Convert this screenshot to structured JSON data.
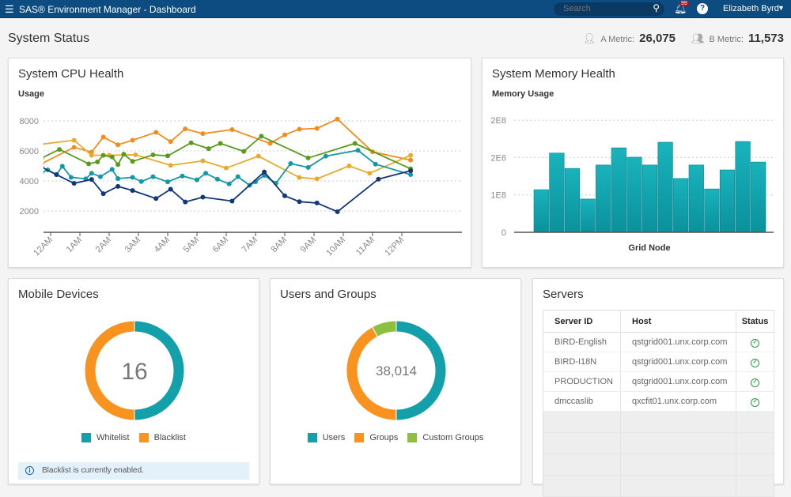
{
  "header": {
    "menu_icon": "hamburger-icon",
    "title": "SAS® Environment Manager - Dashboard",
    "search_placeholder": "Search",
    "notification_count": "99",
    "help_label": "?",
    "user_name": "Elizabeth Byrd"
  },
  "page": {
    "title": "System Status",
    "metric_a_label": "A Metric:",
    "metric_a_value": "26,075",
    "metric_b_label": "B Metric:",
    "metric_b_value": "11,573"
  },
  "cpu": {
    "title": "System CPU Health",
    "subtitle": "Usage"
  },
  "memory": {
    "title": "System Memory Health",
    "subtitle": "Memory Usage"
  },
  "mobile": {
    "title": "Mobile Devices",
    "center": "16",
    "legend": [
      "Whitelist",
      "Blacklist"
    ],
    "info": "Blacklist is currently enabled."
  },
  "users": {
    "title": "Users and Groups",
    "center": "38,014",
    "legend": [
      "Users",
      "Groups",
      "Custom Groups"
    ]
  },
  "servers": {
    "title": "Servers",
    "columns": [
      "Server ID",
      "Host",
      "Status"
    ],
    "rows": [
      [
        "BIRD-English",
        "qstgrid001.unx.corp.com",
        "ok"
      ],
      [
        "BIRD-I18N",
        "qstgrid001.unx.corp.com",
        "ok"
      ],
      [
        "PRODUCTION",
        "qstgrid001.unx.corp.com",
        "ok"
      ],
      [
        "dmccaslib",
        "qxcfit01.unx.corp.com",
        "ok"
      ]
    ]
  },
  "chart_data": [
    {
      "type": "line",
      "title": "System CPU Health",
      "ylabel": "Usage",
      "x_unit": "hour",
      "x_ticks": [
        "12AM",
        "1AM",
        "2AM",
        "3AM",
        "4AM",
        "5AM",
        "6AM",
        "7AM",
        "8AM",
        "9AM",
        "10AM",
        "11AM",
        "12PM"
      ],
      "y_ticks": [
        2000,
        4000,
        6000,
        8000
      ],
      "grid": "horizontal dotted",
      "series": [
        {
          "color": "#f28c1f",
          "points": [
            [
              -0.3,
              5160
            ],
            [
              0.8,
              6240
            ],
            [
              1.4,
              5920
            ],
            [
              1.8,
              6920
            ],
            [
              2.3,
              6410
            ],
            [
              2.8,
              6710
            ],
            [
              3.6,
              7240
            ],
            [
              4.1,
              6620
            ],
            [
              4.6,
              7470
            ],
            [
              5.2,
              7150
            ],
            [
              6.2,
              7420
            ],
            [
              7.5,
              6500
            ],
            [
              8.0,
              7070
            ],
            [
              8.5,
              7450
            ],
            [
              9.1,
              7500
            ],
            [
              9.8,
              8120
            ],
            [
              11.0,
              5940
            ],
            [
              12.3,
              5390
            ]
          ]
        },
        {
          "color": "#e8ac2c",
          "points": [
            [
              -0.3,
              6450
            ],
            [
              0.8,
              6710
            ],
            [
              1.4,
              5710
            ],
            [
              2.0,
              5710
            ],
            [
              2.9,
              5740
            ],
            [
              4.1,
              5040
            ],
            [
              5.2,
              5340
            ],
            [
              6.0,
              4860
            ],
            [
              7.1,
              5650
            ],
            [
              8.5,
              4230
            ],
            [
              9.1,
              4140
            ],
            [
              10.2,
              5000
            ],
            [
              10.9,
              4510
            ],
            [
              12.3,
              5710
            ]
          ]
        },
        {
          "color": "#5a9a1c",
          "points": [
            [
              -0.3,
              5530
            ],
            [
              0.3,
              6100
            ],
            [
              1.3,
              5140
            ],
            [
              1.6,
              5270
            ],
            [
              1.8,
              5710
            ],
            [
              2.1,
              5600
            ],
            [
              2.3,
              5090
            ],
            [
              2.5,
              5780
            ],
            [
              2.8,
              5300
            ],
            [
              3.5,
              5740
            ],
            [
              4.0,
              5670
            ],
            [
              4.8,
              6540
            ],
            [
              5.4,
              6150
            ],
            [
              5.8,
              6500
            ],
            [
              6.6,
              5970
            ],
            [
              7.2,
              6980
            ],
            [
              8.8,
              5530
            ],
            [
              10.4,
              6500
            ],
            [
              12.3,
              4810
            ]
          ]
        },
        {
          "color": "#1697a6",
          "points": [
            [
              -0.3,
              4560
            ],
            [
              -0.1,
              4740
            ],
            [
              0.2,
              4420
            ],
            [
              0.4,
              4980
            ],
            [
              0.7,
              4240
            ],
            [
              1.2,
              4140
            ],
            [
              1.4,
              4510
            ],
            [
              1.7,
              4280
            ],
            [
              2.1,
              4770
            ],
            [
              2.3,
              4160
            ],
            [
              2.8,
              4240
            ],
            [
              3.1,
              3960
            ],
            [
              3.5,
              4280
            ],
            [
              4.0,
              3940
            ],
            [
              4.5,
              4330
            ],
            [
              5.0,
              4070
            ],
            [
              5.3,
              4510
            ],
            [
              5.7,
              4120
            ],
            [
              6.1,
              3800
            ],
            [
              6.4,
              4280
            ],
            [
              6.8,
              3710
            ],
            [
              7.0,
              3940
            ],
            [
              7.3,
              4370
            ],
            [
              7.7,
              3850
            ],
            [
              8.2,
              5160
            ],
            [
              8.8,
              4900
            ],
            [
              9.4,
              5650
            ],
            [
              10.5,
              6040
            ],
            [
              11.1,
              5120
            ],
            [
              12.3,
              4420
            ]
          ]
        },
        {
          "color": "#12377a",
          "points": [
            [
              -0.3,
              4910
            ],
            [
              0.2,
              4420
            ],
            [
              0.8,
              3840
            ],
            [
              1.4,
              4100
            ],
            [
              1.8,
              3150
            ],
            [
              2.3,
              3640
            ],
            [
              2.8,
              3360
            ],
            [
              3.6,
              2830
            ],
            [
              4.1,
              3450
            ],
            [
              4.6,
              2600
            ],
            [
              5.2,
              2920
            ],
            [
              6.2,
              2660
            ],
            [
              7.3,
              4600
            ],
            [
              8.0,
              3010
            ],
            [
              8.5,
              2620
            ],
            [
              9.1,
              2530
            ],
            [
              9.8,
              1950
            ],
            [
              11.2,
              4120
            ],
            [
              12.3,
              4680
            ]
          ]
        }
      ]
    },
    {
      "type": "bar",
      "title": "System Memory Health",
      "ylabel": "Memory Usage",
      "xlabel": "Grid Node",
      "y_tick_labels": [
        "0",
        "1E8",
        "2E6",
        "2E8"
      ],
      "value_unit": "tick steps",
      "values": [
        1.14,
        2.12,
        1.71,
        0.89,
        1.8,
        2.26,
        2.01,
        1.8,
        2.41,
        1.44,
        1.8,
        1.16,
        1.67,
        2.43,
        1.88
      ],
      "color": "#13a3ad",
      "grid": "horizontal dotted"
    },
    {
      "type": "pie",
      "title": "Mobile Devices",
      "center_label": "16",
      "labels": [
        "Whitelist",
        "Blacklist"
      ],
      "values": [
        50,
        50
      ],
      "colors": [
        "#13a0aa",
        "#f7931e"
      ]
    },
    {
      "type": "pie",
      "title": "Users and Groups",
      "center_label": "38,014",
      "labels": [
        "Users",
        "Groups",
        "Custom Groups"
      ],
      "values": [
        50,
        42,
        8
      ],
      "colors": [
        "#13a0aa",
        "#f7931e",
        "#8dc040"
      ]
    }
  ]
}
